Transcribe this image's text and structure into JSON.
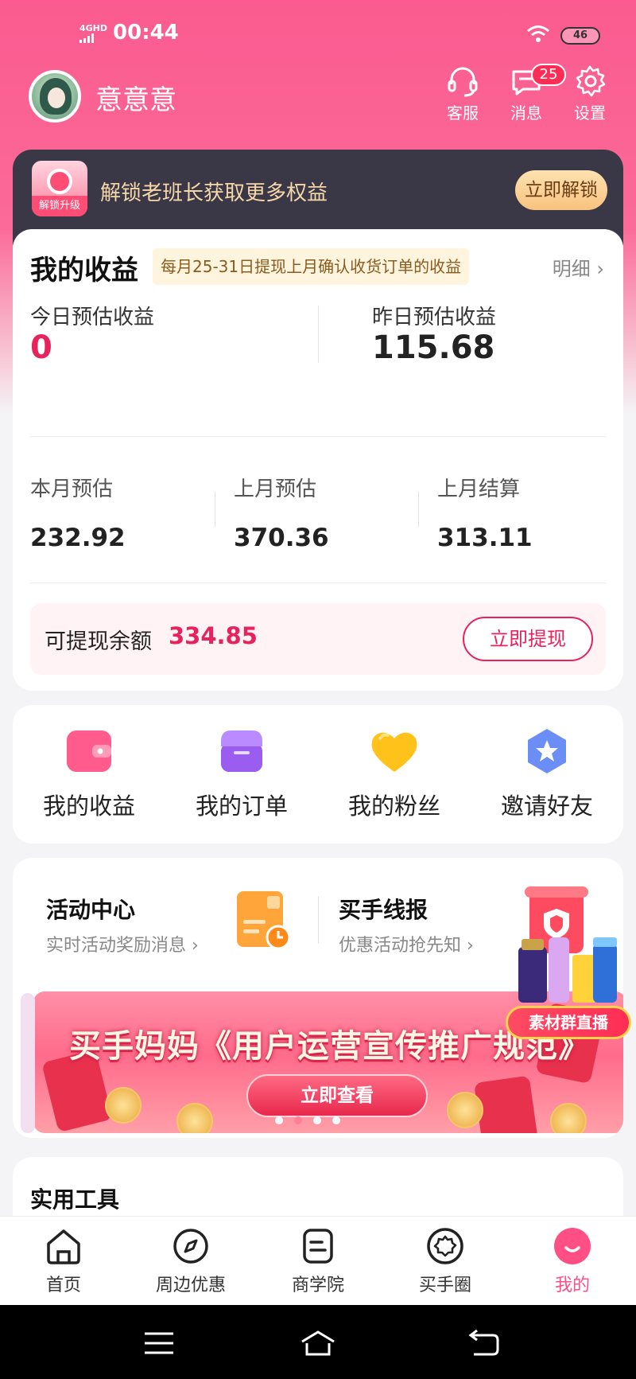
{
  "status_bar": {
    "network": "4GHD",
    "time": "00:44",
    "battery": "46"
  },
  "header": {
    "username": "意意意",
    "buttons": [
      {
        "label": "客服",
        "icon": "headset-icon"
      },
      {
        "label": "消息",
        "icon": "message-icon",
        "badge": "25"
      },
      {
        "label": "设置",
        "icon": "gear-icon"
      }
    ]
  },
  "vip_banner": {
    "icon_caption": "解锁升级",
    "text": "解锁老班长获取更多权益",
    "button": "立即解锁"
  },
  "earnings": {
    "title": "我的收益",
    "note": "每月25-31日提现上月确认收货订单的收益",
    "detail": "明细 ›",
    "today_label": "今日预估收益",
    "today_value": "0",
    "yesterday_label": "昨日预估收益",
    "yesterday_value": "115.68",
    "month_stats": [
      {
        "label": "本月预估",
        "value": "232.92"
      },
      {
        "label": "上月预估",
        "value": "370.36"
      },
      {
        "label": "上月结算",
        "value": "313.11"
      }
    ],
    "withdraw_label": "可提现余额",
    "withdraw_value": "334.85",
    "withdraw_button": "立即提现"
  },
  "quick_menu": [
    {
      "label": "我的收益",
      "icon": "wallet-icon"
    },
    {
      "label": "我的订单",
      "icon": "shop-icon"
    },
    {
      "label": "我的粉丝",
      "icon": "heart-icon"
    },
    {
      "label": "邀请好友",
      "icon": "star-hexagon-icon"
    }
  ],
  "activity": {
    "left_title": "活动中心",
    "left_sub": "实时活动奖励消息 ›",
    "right_title": "买手线报",
    "right_sub": "优惠活动抢先知 ›",
    "banner_title": "买手妈妈《用户运营宣传推广规范》",
    "banner_button": "立即查看",
    "banner_dots": 4,
    "banner_active_dot": 1
  },
  "live_widget": {
    "label": "素材群直播"
  },
  "tools": {
    "title": "实用工具"
  },
  "tabbar": [
    {
      "label": "首页",
      "icon": "home-icon",
      "active": false
    },
    {
      "label": "周边优惠",
      "icon": "compass-icon",
      "active": false
    },
    {
      "label": "商学院",
      "icon": "book-icon",
      "active": false
    },
    {
      "label": "买手圈",
      "icon": "circle-icon",
      "active": false
    },
    {
      "label": "我的",
      "icon": "profile-icon",
      "active": true
    }
  ],
  "colors": {
    "brand_pink": "#fb5b90",
    "accent_red": "#e8225c",
    "dark_banner": "#3a3747",
    "gold_text": "#f5d7a8"
  }
}
